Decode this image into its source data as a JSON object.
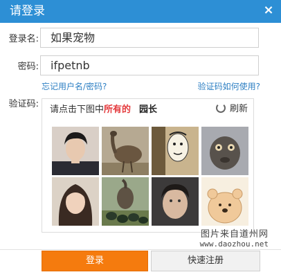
{
  "dialog": {
    "title": "请登录",
    "close_symbol": "×"
  },
  "form": {
    "username_label": "登录名:",
    "username_value": "如果宠物",
    "password_label": "密码:",
    "password_value": "ifpetnb",
    "forgot_link": "忘记用户名/密码?",
    "captcha_help_link": "验证码如何使用?",
    "captcha_label": "验证码:"
  },
  "captcha": {
    "instruction_prefix": "请点击下图中",
    "instruction_emphasis": "所有的",
    "target_word": "园长",
    "refresh_label": "刷新",
    "refresh_icon": "refresh-icon",
    "tiles": [
      {
        "name": "captcha-tile-man-portrait"
      },
      {
        "name": "captcha-tile-emu"
      },
      {
        "name": "captcha-tile-meme-face"
      },
      {
        "name": "captcha-tile-emu-closeup"
      },
      {
        "name": "captcha-tile-woman-portrait"
      },
      {
        "name": "captcha-tile-emu-eggs"
      },
      {
        "name": "captcha-tile-man-face"
      },
      {
        "name": "captcha-tile-cartoon-bear"
      }
    ]
  },
  "buttons": {
    "login": "登录",
    "register": "快速注册"
  },
  "watermark": {
    "line1": "图片来自道州网",
    "line2": "www.daozhou.net"
  },
  "colors": {
    "title_bar": "#2d8fd5",
    "link": "#2d7fc3",
    "emphasis": "#e4393c",
    "login_button": "#f57b0e"
  }
}
